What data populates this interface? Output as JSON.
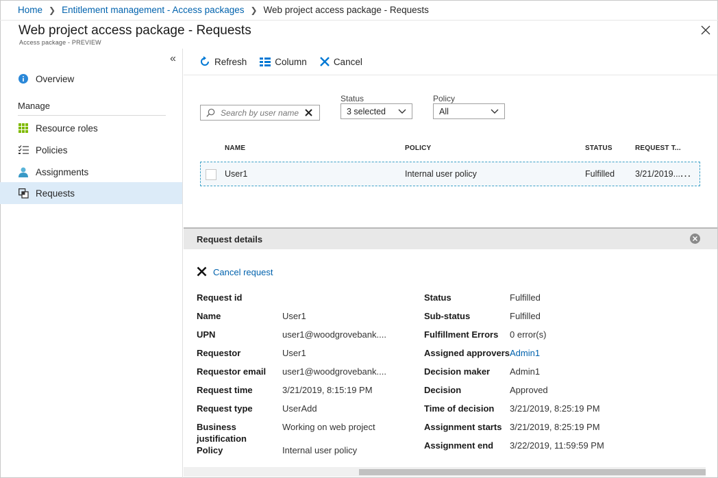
{
  "breadcrumb": {
    "items": [
      "Home",
      "Entitlement management - Access packages"
    ],
    "current": "Web project access package - Requests"
  },
  "header": {
    "title": "Web project access package - Requests",
    "subtitle": "Access package - PREVIEW"
  },
  "sidebar": {
    "overview": "Overview",
    "section": "Manage",
    "items": [
      {
        "label": "Resource roles",
        "icon": "grid-icon"
      },
      {
        "label": "Policies",
        "icon": "checklist-icon"
      },
      {
        "label": "Assignments",
        "icon": "user-icon"
      },
      {
        "label": "Requests",
        "icon": "requests-icon",
        "active": true
      }
    ]
  },
  "toolbar": {
    "refresh": "Refresh",
    "column": "Column",
    "cancel": "Cancel"
  },
  "filters": {
    "search_placeholder": "Search by user name",
    "status_label": "Status",
    "status_value": "3 selected",
    "policy_label": "Policy",
    "policy_value": "All"
  },
  "table": {
    "columns": [
      "NAME",
      "POLICY",
      "STATUS",
      "REQUEST T..."
    ],
    "rows": [
      {
        "name": "User1",
        "policy": "Internal user policy",
        "status": "Fulfilled",
        "request_time": "3/21/2019..."
      }
    ]
  },
  "details": {
    "header": "Request details",
    "cancel_request": "Cancel request",
    "left": [
      {
        "label": "Request id",
        "value": ""
      },
      {
        "label": "Name",
        "value": "User1"
      },
      {
        "label": "UPN",
        "value": "user1@woodgrovebank...."
      },
      {
        "label": "Requestor",
        "value": "User1"
      },
      {
        "label": "Requestor email",
        "value": "user1@woodgrovebank...."
      },
      {
        "label": "Request time",
        "value": "3/21/2019, 8:15:19 PM"
      },
      {
        "label": "Request type",
        "value": "UserAdd"
      },
      {
        "label": "Business justification",
        "value": "Working on web project"
      },
      {
        "label": "Policy",
        "value": "Internal user policy"
      }
    ],
    "right": [
      {
        "label": "Status",
        "value": "Fulfilled"
      },
      {
        "label": "Sub-status",
        "value": "Fulfilled"
      },
      {
        "label": "Fulfillment Errors",
        "value": "0 error(s)"
      },
      {
        "label": "Assigned approvers",
        "value": "Admin1"
      },
      {
        "label": "Decision maker",
        "value": "Admin1"
      },
      {
        "label": "Decision",
        "value": "Approved"
      },
      {
        "label": "Time of decision",
        "value": "3/21/2019, 8:25:19 PM"
      },
      {
        "label": "Assignment starts",
        "value": "3/21/2019, 8:25:19 PM"
      },
      {
        "label": "Assignment end",
        "value": "3/22/2019, 11:59:59 PM"
      }
    ]
  },
  "colors": {
    "link": "#0062ad",
    "active_nav": "#dcebf8",
    "accent": "#0078d4"
  }
}
